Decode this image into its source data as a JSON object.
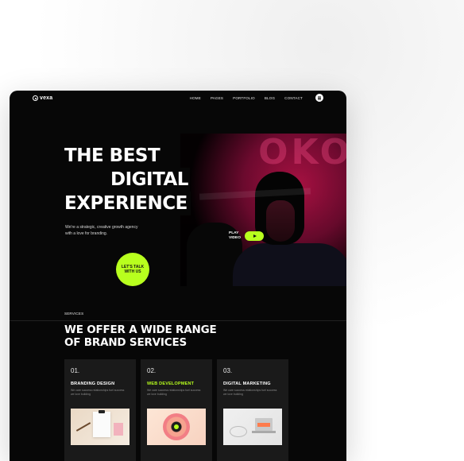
{
  "nav": {
    "logo": "vexa",
    "menu": [
      "HOME",
      "PAGES",
      "PORTFOLIO",
      "BLOG",
      "CONTACT"
    ]
  },
  "hero": {
    "headline": [
      "THE BEST",
      "DIGITAL",
      "EXPERIENCE"
    ],
    "text": "We're a strategic, creative growth agency with a love for branding.",
    "play_label": "PLAY VIDEO",
    "cta_label": "LET'S TALK WITH US"
  },
  "services": {
    "label": "SERVICES",
    "title_line1": "WE OFFER A WIDE RANGE",
    "title_line2": "OF BRAND SERVICES",
    "cards": [
      {
        "num": "01.",
        "title": "BRANDING DESIGN",
        "desc": "We care success relationships fuel success we love building"
      },
      {
        "num": "02.",
        "title": "WEB DEVELOPMENT",
        "desc": "We care success relationships fuel success we love building"
      },
      {
        "num": "03.",
        "title": "DIGITAL MARKETING",
        "desc": "We care success relationships fuel success we love building"
      }
    ]
  },
  "colors": {
    "accent": "#b8ff1e",
    "background": "#070707",
    "hero_tint": "#c41a5a"
  },
  "icons": {
    "menu": "hamburger-icon",
    "play": "play-icon",
    "logo": "vexa-logo-icon"
  }
}
